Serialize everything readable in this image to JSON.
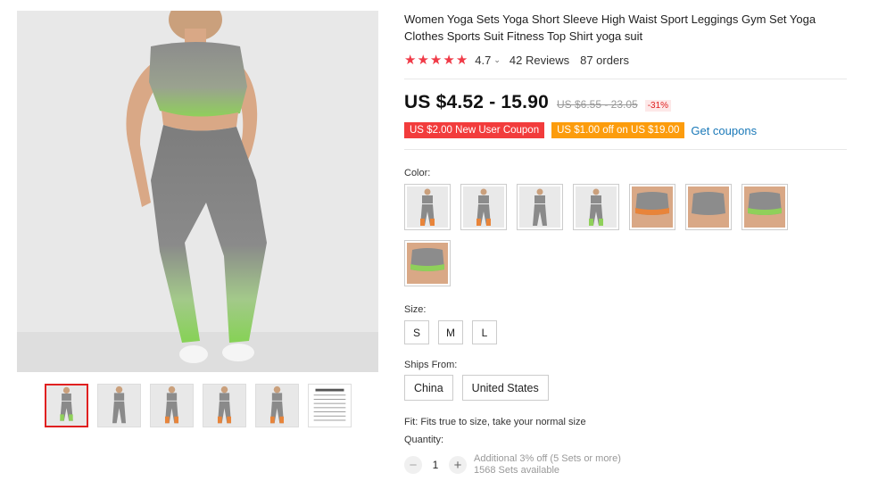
{
  "product": {
    "title": "Women Yoga Sets Yoga Short Sleeve High Waist Sport Leggings Gym Set Yoga Clothes Sports Suit Fitness Top Shirt yoga suit",
    "rating": "4.7",
    "reviews": "42 Reviews",
    "orders": "87 orders"
  },
  "price": {
    "current": "US $4.52 - 15.90",
    "original": "US $6.55 - 23.05",
    "discount": "-31%"
  },
  "coupons": {
    "new_user": "US $2.00 New User Coupon",
    "off": "US $1.00 off on US $19.00",
    "get_link": "Get coupons"
  },
  "color": {
    "label": "Color:",
    "swatches": [
      "full-body-1",
      "full-body-2",
      "full-body-3",
      "full-body-4",
      "top-1",
      "top-2",
      "top-3",
      "top-4"
    ]
  },
  "size": {
    "label": "Size:",
    "options": [
      "S",
      "M",
      "L"
    ]
  },
  "ships_from": {
    "label": "Ships From:",
    "options": [
      "China",
      "United States"
    ]
  },
  "fit": "Fit: Fits true to size, take your normal size",
  "quantity": {
    "label": "Quantity:",
    "value": "1",
    "note_line1": "Additional 3% off (5 Sets or more)",
    "note_line2": "1568 Sets available"
  },
  "colors": {
    "accent_red": "#f03a47",
    "coupon_red": "#f23c3c",
    "coupon_orange": "#fc9c0c",
    "link_blue": "#1978b8",
    "outfit_gray": "#8a8a8a",
    "outfit_green": "#8fd05a"
  },
  "icons": {
    "star": "star-icon",
    "chevron": "chevron-down-icon",
    "minus": "minus-icon",
    "plus": "plus-icon"
  }
}
